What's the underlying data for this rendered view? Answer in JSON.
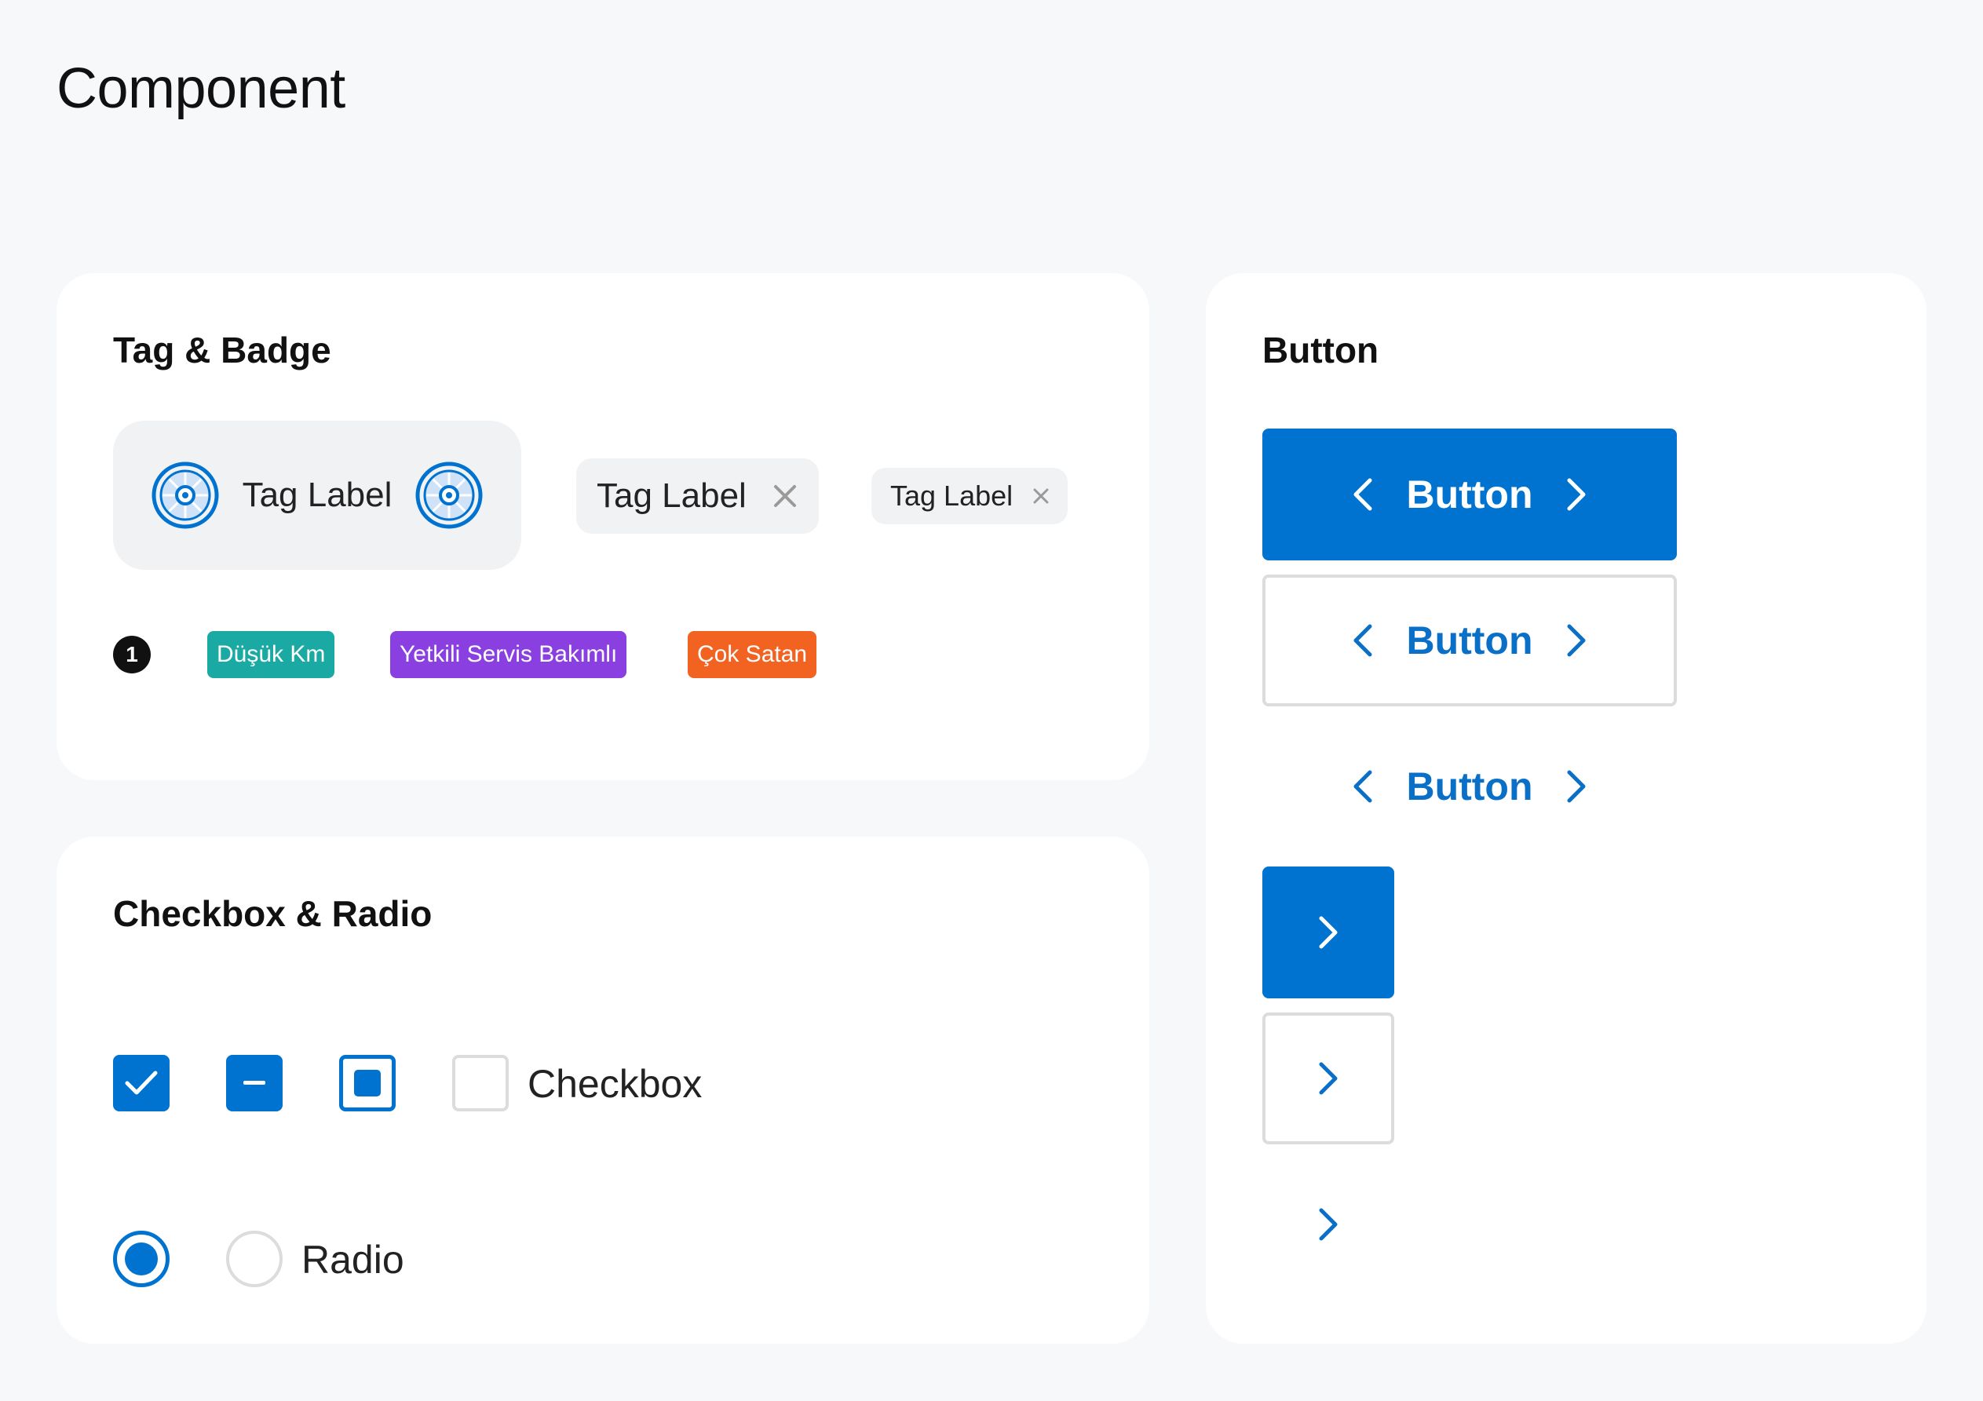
{
  "page": {
    "title": "Component"
  },
  "colors": {
    "primary": "#0073d1",
    "teal": "#1ba9a3",
    "purple": "#8a3fe0",
    "orange": "#f26322",
    "tag_bg": "#f1f2f4",
    "border": "#dcdcdc"
  },
  "tag_badge": {
    "title": "Tag & Badge",
    "tags": [
      {
        "label": "Tag Label",
        "size": "large",
        "icons": [
          "wheel-icon",
          "wheel-icon"
        ]
      },
      {
        "label": "Tag Label",
        "size": "medium",
        "icon": "close-icon"
      },
      {
        "label": "Tag Label",
        "size": "small",
        "icon": "close-icon"
      }
    ],
    "count_badge": "1",
    "badges": [
      {
        "label": "Düşük Km",
        "color": "#1ba9a3"
      },
      {
        "label": "Yetkili Servis Bakımlı",
        "color": "#8a3fe0"
      },
      {
        "label": "Çok Satan",
        "color": "#f26322"
      }
    ]
  },
  "checkbox_radio": {
    "title": "Checkbox & Radio",
    "checkbox_states": [
      "checked",
      "indeterminate",
      "focused-filled",
      "unchecked"
    ],
    "checkbox_label": "Checkbox",
    "radio_states": [
      "selected",
      "unselected"
    ],
    "radio_label": "Radio"
  },
  "buttons": {
    "title": "Button",
    "items": [
      {
        "label": "Button",
        "variant": "primary",
        "icons": [
          "chevron-left-icon",
          "chevron-right-icon"
        ]
      },
      {
        "label": "Button",
        "variant": "outline",
        "icons": [
          "chevron-left-icon",
          "chevron-right-icon"
        ]
      },
      {
        "label": "Button",
        "variant": "ghost",
        "icons": [
          "chevron-left-icon",
          "chevron-right-icon"
        ]
      }
    ],
    "icon_buttons": [
      {
        "variant": "primary",
        "icon": "chevron-right-icon"
      },
      {
        "variant": "outline",
        "icon": "chevron-right-icon"
      },
      {
        "variant": "ghost",
        "icon": "chevron-right-icon"
      }
    ]
  }
}
